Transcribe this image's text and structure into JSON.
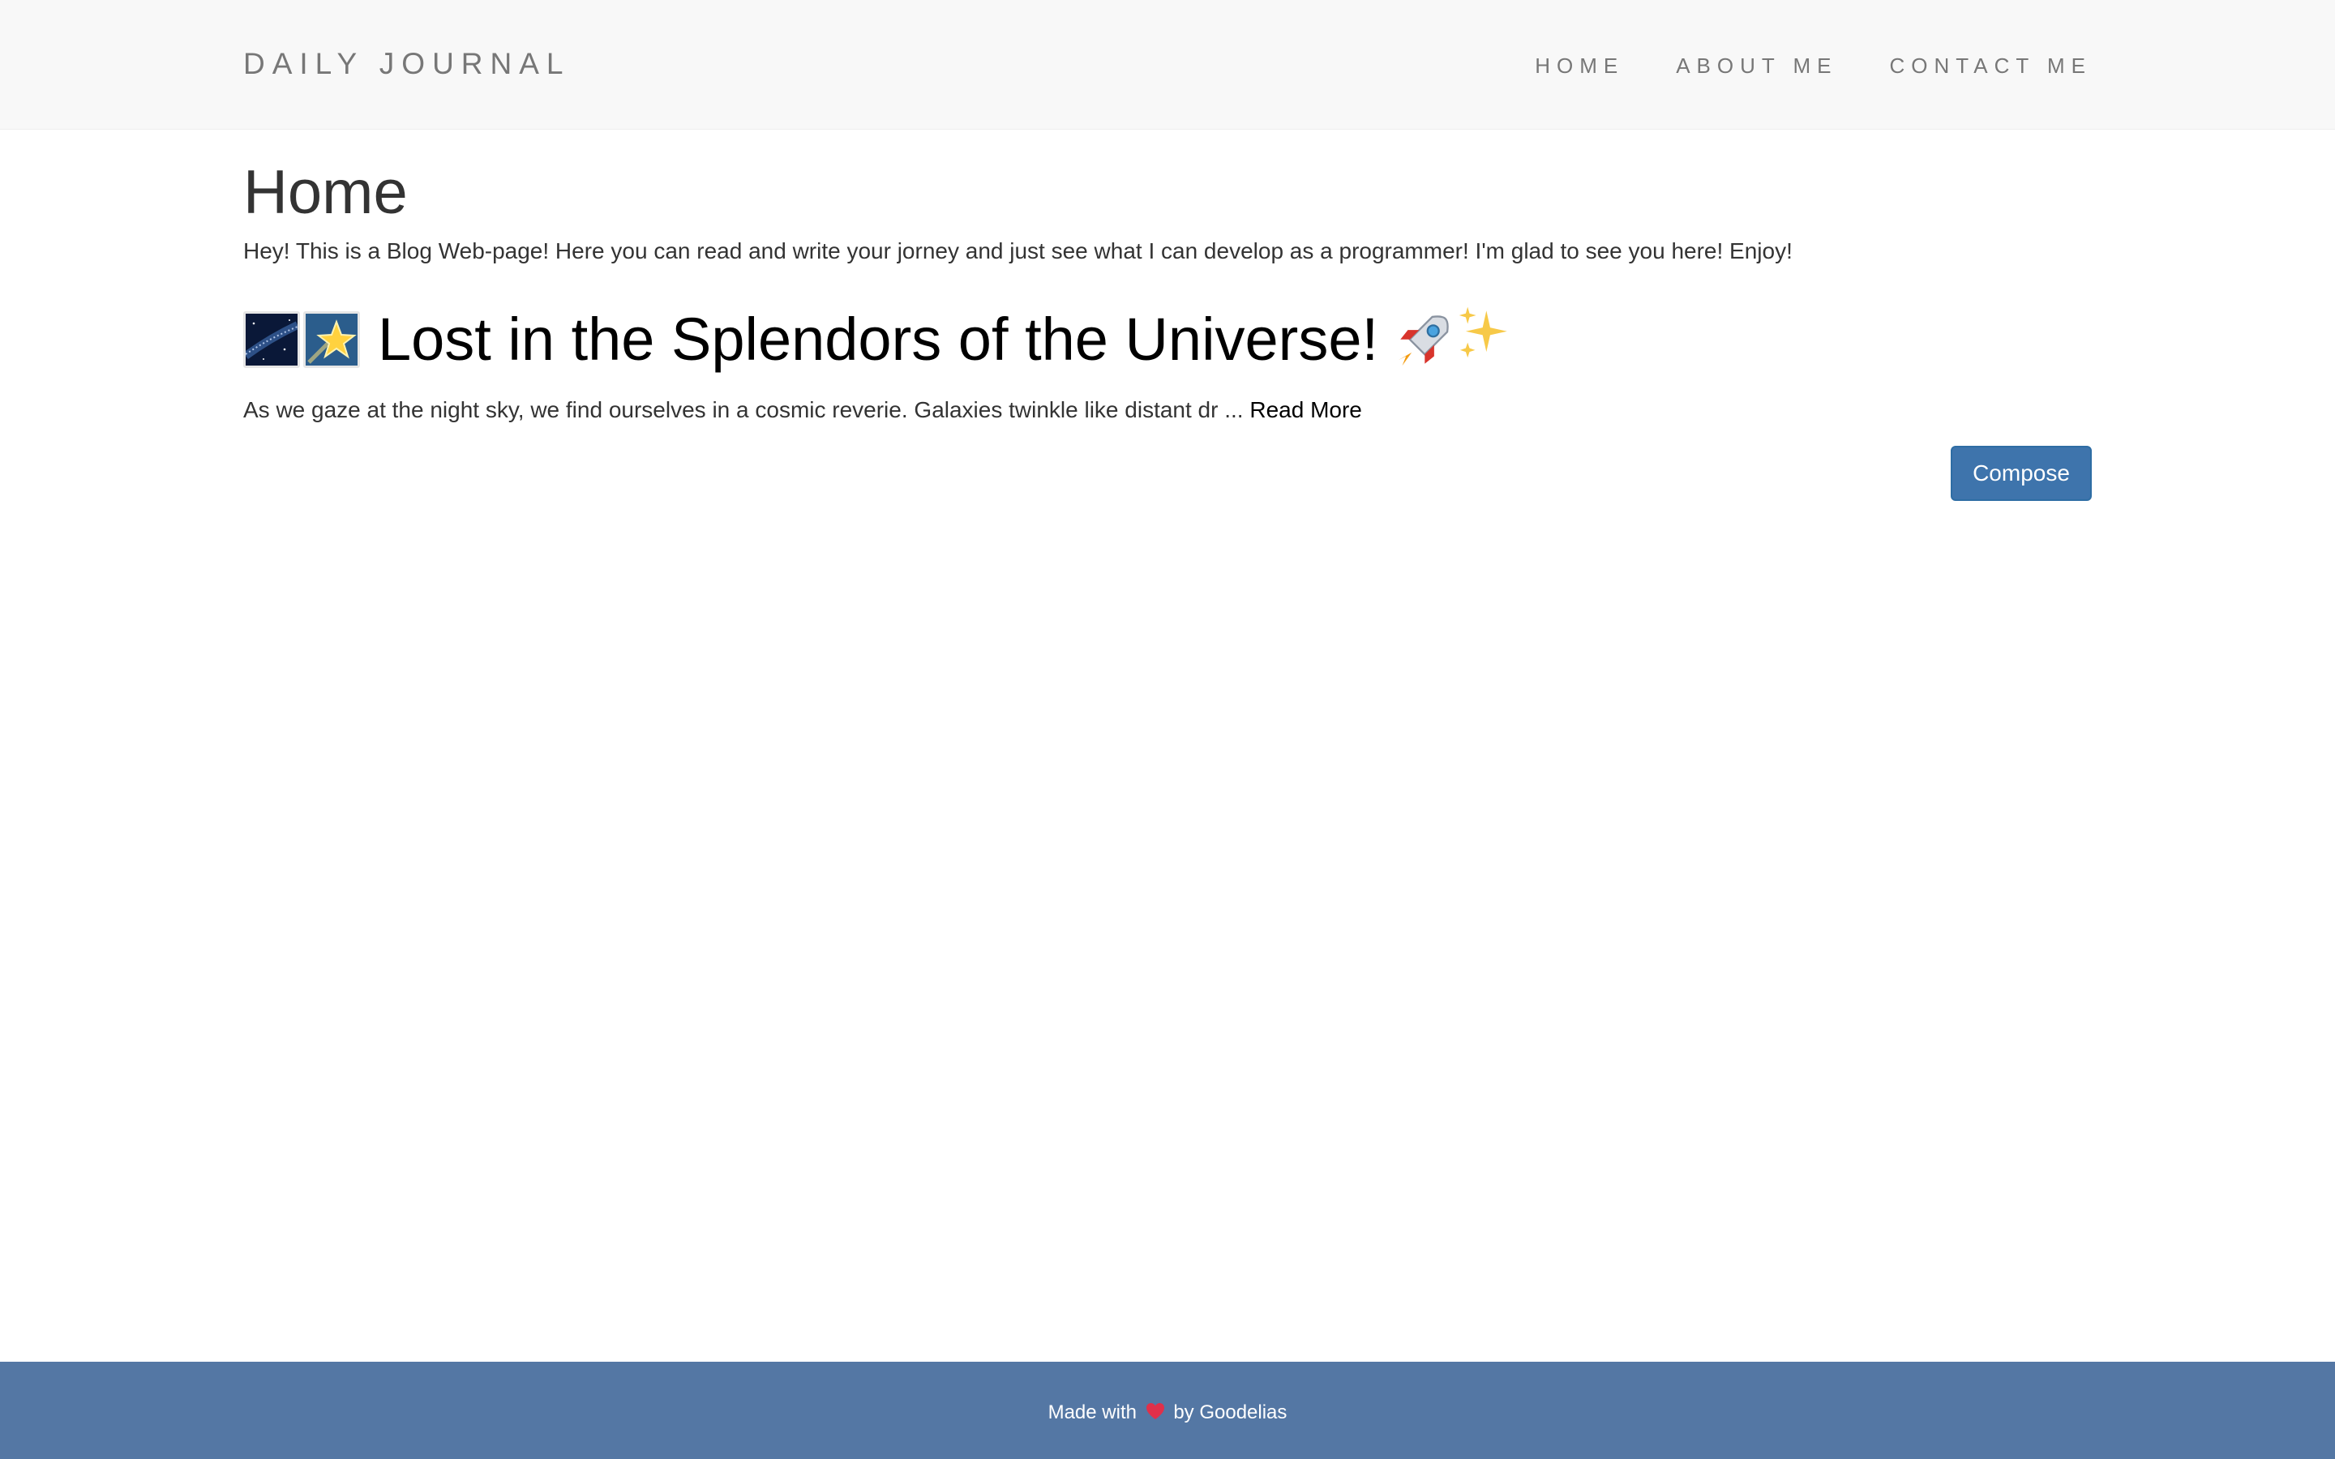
{
  "navbar": {
    "brand": "DAILY JOURNAL",
    "links": [
      "HOME",
      "ABOUT ME",
      "CONTACT ME"
    ]
  },
  "main": {
    "page_title": "Home",
    "intro": "Hey! This is a Blog Web-page! Here you can read and write your jorney and just see what I can develop as a programmer! I'm glad to see you here! Enjoy!",
    "post": {
      "title": "Lost in the Splendors of the Universe!",
      "excerpt": "As we gaze at the night sky, we find ourselves in a cosmic reverie. Galaxies twinkle like distant dr ...",
      "read_more": "Read More",
      "title_icons": [
        "milky-way-icon",
        "shooting-star-icon"
      ],
      "trailing_icons": [
        "rocket-icon",
        "sparkles-icon"
      ]
    },
    "compose_label": "Compose"
  },
  "footer": {
    "text_before": "Made with",
    "text_after": "by Goodelias",
    "icon": "heart-icon"
  },
  "colors": {
    "navbar_bg": "#f8f8f8",
    "brand_text": "#777777",
    "button_bg": "#3e74ac",
    "footer_bg": "#5477a4"
  }
}
